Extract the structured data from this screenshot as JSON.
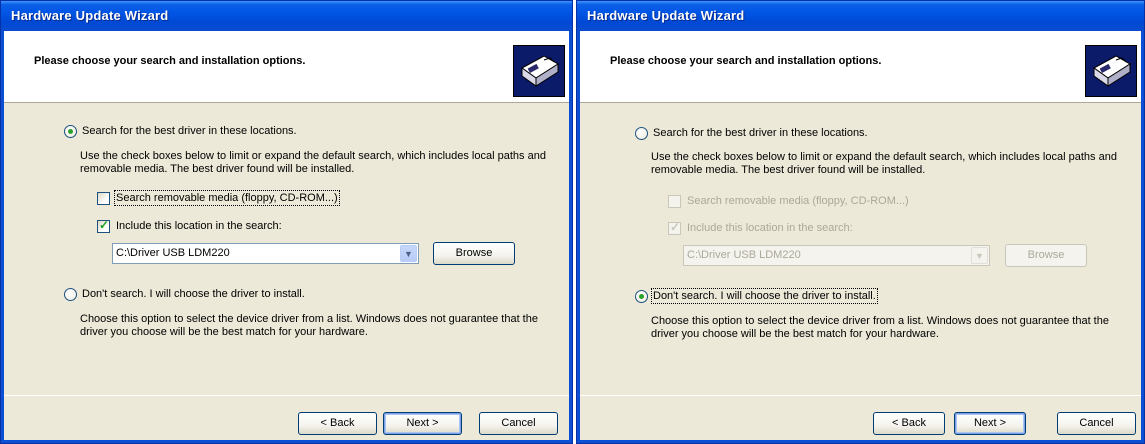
{
  "windows": [
    {
      "title": "Hardware Update Wizard",
      "heading": "Please choose your search and installation options.",
      "radio_search_label": "Search for the best driver in these locations.",
      "search_description": "Use the check boxes below to limit or expand the default search, which includes local paths and removable media. The best driver found will be installed.",
      "checkbox_removable_label": "Search removable media (floppy, CD-ROM...)",
      "checkbox_location_label": "Include this location in the search:",
      "location_value": "C:\\Driver USB LDM220",
      "browse_label": "Browse",
      "radio_dont_search_label": "Don't search. I will choose the driver to install.",
      "dont_search_description": "Choose this option to select the device driver from a list.  Windows does not guarantee that the driver you choose will be the best match for your hardware.",
      "back_label": "< Back",
      "next_label": "Next >",
      "cancel_label": "Cancel",
      "selected_option": "search",
      "removable_checked": false,
      "location_checked": true
    },
    {
      "title": "Hardware Update Wizard",
      "heading": "Please choose your search and installation options.",
      "radio_search_label": "Search for the best driver in these locations.",
      "search_description": "Use the check boxes below to limit or expand the default search, which includes local paths and removable media. The best driver found will be installed.",
      "checkbox_removable_label": "Search removable media (floppy, CD-ROM...)",
      "checkbox_location_label": "Include this location in the search:",
      "location_value": "C:\\Driver USB LDM220",
      "browse_label": "Browse",
      "radio_dont_search_label": "Don't search. I will choose the driver to install.",
      "dont_search_description": "Choose this option to select the device driver from a list.  Windows does not guarantee that the driver you choose will be the best match for your hardware.",
      "back_label": "< Back",
      "next_label": "Next >",
      "cancel_label": "Cancel",
      "selected_option": "dont_search",
      "removable_checked": false,
      "location_checked": true
    }
  ],
  "colors": {
    "titlebar": "#0055e5",
    "dialog_bg": "#ece9d8",
    "radio_dot": "#2aa02a",
    "disabled_text": "#aca899"
  },
  "icons": {
    "wizard": "hardware-card-icon",
    "combo_arrow": "chevron-down-icon"
  }
}
